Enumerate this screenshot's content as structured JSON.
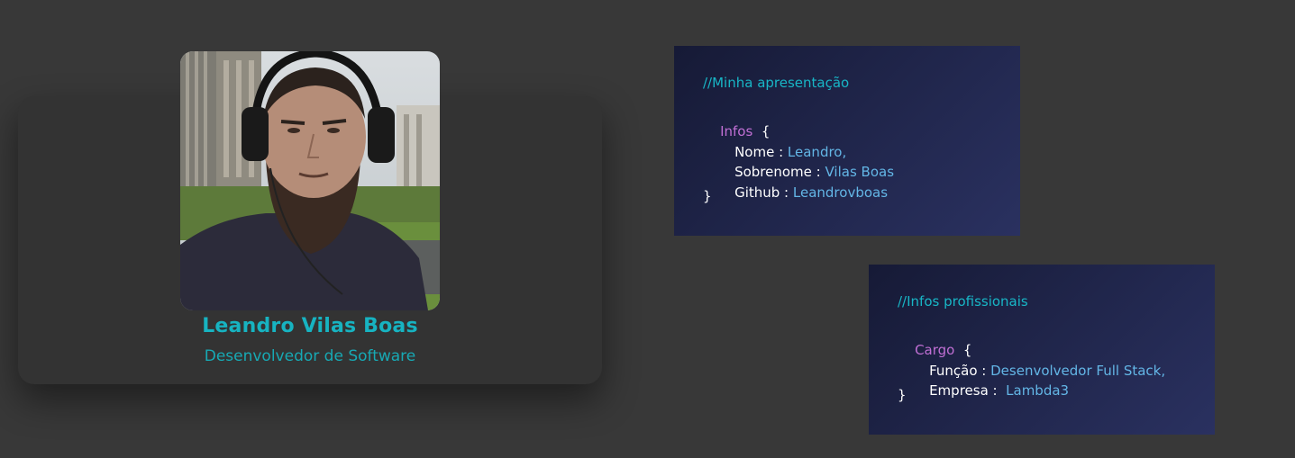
{
  "profile": {
    "name": "Leandro Vilas Boas",
    "role": "Desenvolvedor de Software"
  },
  "card_presentation": {
    "comment": "//Minha apresentação",
    "object_name": "Infos",
    "open_brace": "{",
    "close_brace": "}",
    "fields": [
      {
        "key": "Nome :",
        "value": "Leandro,"
      },
      {
        "key": "Sobrenome :",
        "value": "Vilas Boas"
      },
      {
        "key": "Github :",
        "value": "Leandrovboas"
      }
    ]
  },
  "card_professional": {
    "comment": "//Infos profissionais",
    "object_name": "Cargo",
    "open_brace": "{",
    "close_brace": "}",
    "fields": [
      {
        "key": "Função :",
        "value": "Desenvolvedor Full Stack,"
      },
      {
        "key": "Empresa :",
        "value": "Lambda3"
      }
    ]
  },
  "colors": {
    "background": "#383838",
    "card": "#333333",
    "accent_teal": "#17b3c1",
    "keyword_purple": "#c06fd4",
    "value_blue": "#63b6e6"
  }
}
